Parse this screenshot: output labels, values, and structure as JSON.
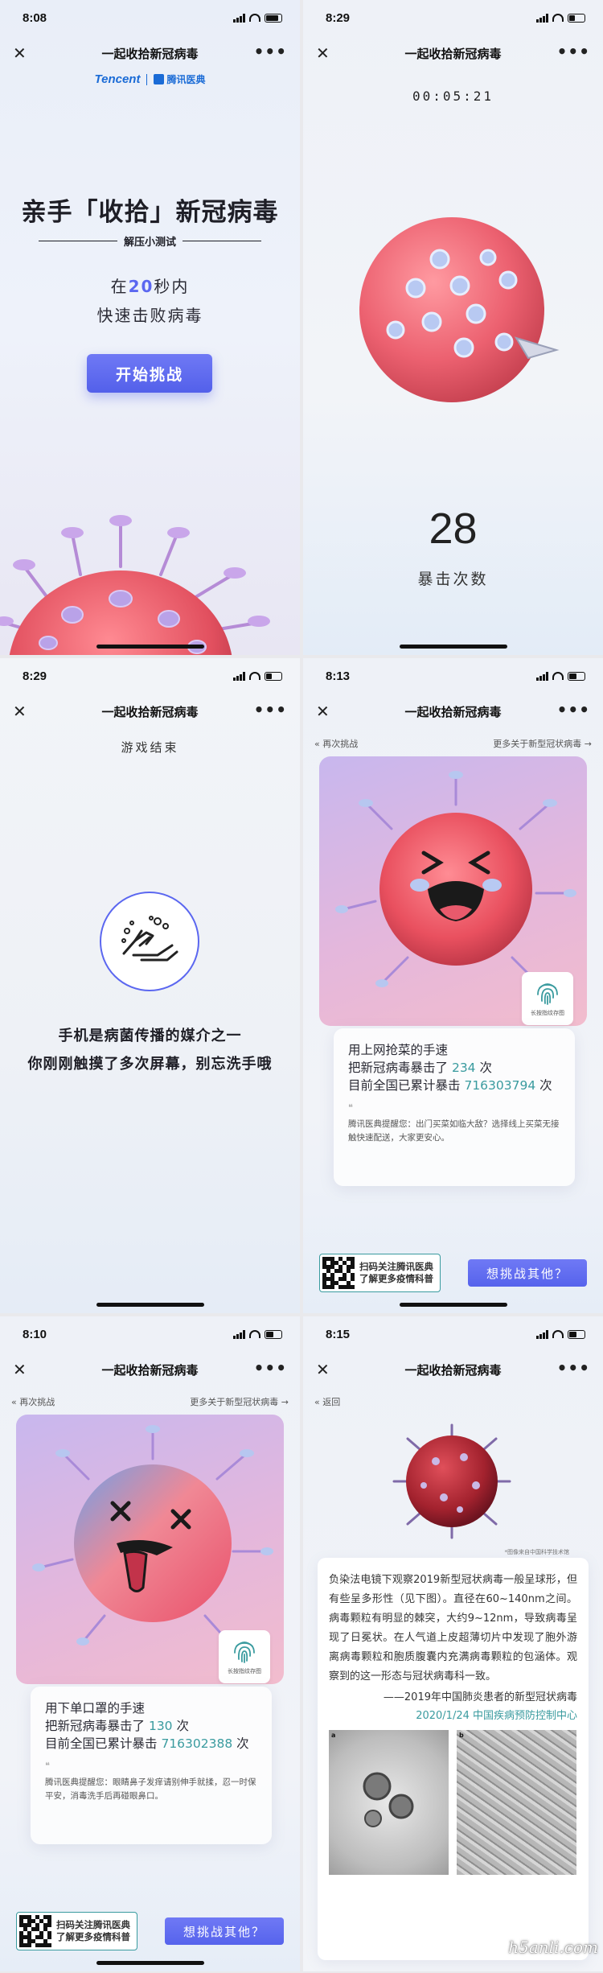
{
  "colors": {
    "accent": "#5b67f0",
    "teal": "#3a9b9f",
    "virus": "#e35a6a",
    "card_purple": "#c8b7ee"
  },
  "screens": [
    {
      "time": "8:08",
      "nav_title": "一起收拾新冠病毒",
      "brand_tencent": "Tencent",
      "brand_yidian": "腾讯医典",
      "headline": "亲手「收拾」新冠病毒",
      "subline": "解压小测试",
      "goal_prefix": "在",
      "goal_seconds": "20",
      "goal_suffix": "秒内",
      "goal_line2": "快速击败病毒",
      "start_button": "开始挑战"
    },
    {
      "time": "8:29",
      "nav_title": "一起收拾新冠病毒",
      "timer": "00:05:21",
      "hit_count": "28",
      "hit_label": "暴击次数"
    },
    {
      "time": "8:29",
      "nav_title": "一起收拾新冠病毒",
      "over_title": "游戏结束",
      "message_line1": "手机是病菌传播的媒介之一",
      "message_line2": "你刚刚触摸了多次屏幕，别忘洗手哦"
    },
    {
      "time": "8:13",
      "nav_title": "一起收拾新冠病毒",
      "retry_link": "再次挑战",
      "more_link": "更多关于新型冠状病毒",
      "fingerprint_label": "长按指纹存图",
      "line1": "用上网抢菜的手速",
      "line2_prefix": "把新冠病毒暴击了",
      "line2_num": "234",
      "line2_suffix": "次",
      "line3_prefix": "目前全国已累计暴击",
      "line3_num": "716303794",
      "line3_suffix": "次",
      "quote_mark": "❝",
      "tip": "腾讯医典提醒您：出门买菜如临大敌？选择线上买菜无接触快速配送，大家更安心。",
      "qr_line1": "扫码关注腾讯医典",
      "qr_line2": "了解更多疫情科普",
      "challenge_button": "想挑战其他？"
    },
    {
      "time": "8:10",
      "nav_title": "一起收拾新冠病毒",
      "retry_link": "再次挑战",
      "more_link": "更多关于新型冠状病毒",
      "fingerprint_label": "长按指纹存图",
      "line1": "用下单口罩的手速",
      "line2_prefix": "把新冠病毒暴击了",
      "line2_num": "130",
      "line2_suffix": "次",
      "line3_prefix": "目前全国已累计暴击",
      "line3_num": "716302388",
      "line3_suffix": "次",
      "quote_mark": "❝",
      "tip": "腾讯医典提醒您：眼睛鼻子发痒请别伸手就揉，忍一时保平安，消毒洗手后再碰眼鼻口。",
      "qr_line1": "扫码关注腾讯医典",
      "qr_line2": "了解更多疫情科普",
      "challenge_button": "想挑战其他？"
    },
    {
      "time": "8:15",
      "nav_title": "一起收拾新冠病毒",
      "back_link": "返回",
      "photo_credit": "*图像来自中国科学技术馆",
      "paragraph": "负染法电镜下观察2019新型冠状病毒一般呈球形，但有些呈多形性（见下图）。直径在60~140nm之间。病毒颗粒有明显的棘突，大约9~12nm，导致病毒呈现了日冕状。在人气道上皮超薄切片中发现了胞外游离病毒颗粒和胞质腹囊内充满病毒颗粒的包涵体。观察到的这一形态与冠状病毒科一致。",
      "quote": "——2019年中国肺炎患者的新型冠状病毒",
      "source": "2020/1/24 中国疾病预防控制中心",
      "em_tag_a": "a",
      "em_tag_b": "b"
    }
  ],
  "watermark": "h5anli.com"
}
